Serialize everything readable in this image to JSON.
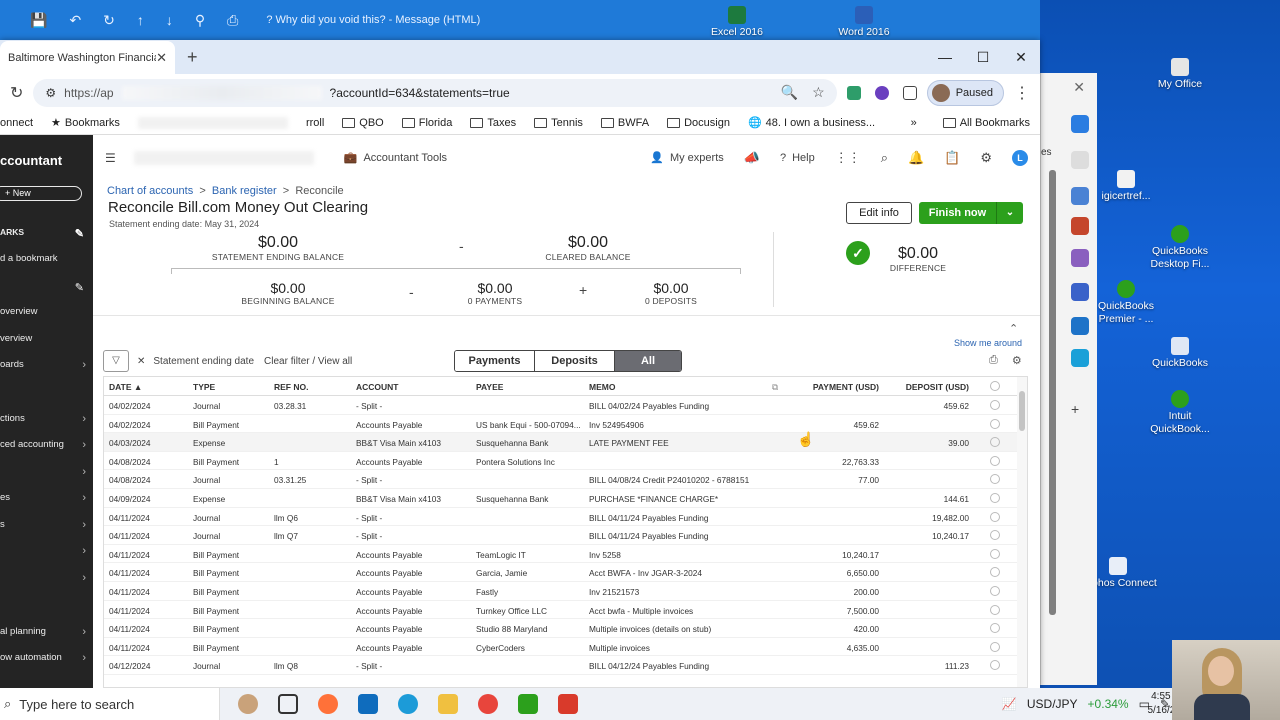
{
  "top_strip": {
    "message_title": "? Why did you void this? - Message (HTML)",
    "excel_label": "Excel 2016",
    "word_label": "Word 2016"
  },
  "desktop_icons": [
    {
      "label": "My Office"
    },
    {
      "label": "igicertref..."
    },
    {
      "label": "QuickBooks Desktop Fi..."
    },
    {
      "label": "QuickBooks Premier - ..."
    },
    {
      "label": "QuickBooks"
    },
    {
      "label": "Intuit QuickBook..."
    },
    {
      "label": "Sophos Connect"
    }
  ],
  "side_panel": {
    "label": "es"
  },
  "browser": {
    "tab_title": "Baltimore Washington Financial",
    "url_prefix": "https://ap",
    "url_suffix": "?accountId=634&statements=true",
    "profile_status": "Paused",
    "bookmarks": {
      "first": "onnect",
      "bookmarks_label": "Bookmarks",
      "items": [
        "rroll",
        "QBO",
        "Florida",
        "Taxes",
        "Tennis",
        "BWFA",
        "Docusign",
        "48. I own a business..."
      ],
      "all_bookmarks": "All Bookmarks"
    }
  },
  "leftnav": {
    "brand": "ccountant",
    "new_label": "+ New",
    "items": [
      {
        "label": "ARKS"
      },
      {
        "label": "d a bookmark"
      },
      {
        "label": "overview"
      },
      {
        "label": "verview"
      },
      {
        "label": "oards"
      },
      {
        "label": "ctions"
      },
      {
        "label": "ced accounting"
      },
      {
        "label": "es"
      },
      {
        "label": "s"
      },
      {
        "label": "al planning"
      },
      {
        "label": "ow automation"
      }
    ]
  },
  "topbar": {
    "accountant_tools": "Accountant Tools",
    "my_experts": "My experts",
    "help": "Help"
  },
  "page": {
    "crumb_1": "Chart of accounts",
    "crumb_2": "Bank register",
    "crumb_3": "Reconcile",
    "title": "Reconcile   Bill.com Money Out Clearing",
    "statement_date": "Statement ending date: May 31, 2024",
    "edit_info": "Edit info",
    "finish_now": "Finish now",
    "show_me_around": "Show me around"
  },
  "balances": {
    "statement_ending": {
      "amount": "$0.00",
      "label": "STATEMENT ENDING BALANCE"
    },
    "cleared": {
      "amount": "$0.00",
      "label": "CLEARED BALANCE"
    },
    "beginning": {
      "amount": "$0.00",
      "label": "BEGINNING BALANCE"
    },
    "payments": {
      "amount": "$0.00",
      "label": "0 PAYMENTS"
    },
    "deposits": {
      "amount": "$0.00",
      "label": "0 DEPOSITS"
    },
    "difference": {
      "amount": "$0.00",
      "label": "DIFFERENCE"
    },
    "minus": "-",
    "plus": "+"
  },
  "filters": {
    "filter_chip": "Statement ending date",
    "clear_filter": "Clear filter / View all",
    "seg_payments": "Payments",
    "seg_deposits": "Deposits",
    "seg_all": "All"
  },
  "table": {
    "headers": {
      "date": "DATE ▲",
      "type": "TYPE",
      "ref": "REF NO.",
      "account": "ACCOUNT",
      "payee": "PAYEE",
      "memo": "MEMO",
      "payment": "PAYMENT (USD)",
      "deposit": "DEPOSIT (USD)"
    },
    "rows": [
      {
        "date": "04/02/2024",
        "type": "Journal",
        "ref": "03.28.31",
        "account": "- Split -",
        "payee": "",
        "memo": "BILL 04/02/24 Payables Funding",
        "payment": "",
        "deposit": "459.62"
      },
      {
        "date": "04/02/2024",
        "type": "Bill Payment",
        "ref": "",
        "account": "Accounts Payable",
        "payee": "US bank Equi - 500-07094...",
        "memo": "Inv 524954906",
        "payment": "459.62",
        "deposit": ""
      },
      {
        "date": "04/03/2024",
        "type": "Expense",
        "ref": "",
        "account": "BB&T Visa Main x4103",
        "payee": "Susquehanna Bank",
        "memo": "LATE PAYMENT FEE",
        "payment": "",
        "deposit": "39.00"
      },
      {
        "date": "04/08/2024",
        "type": "Bill Payment",
        "ref": "1",
        "account": "Accounts Payable",
        "payee": "Pontera Solutions Inc",
        "memo": "",
        "payment": "22,763.33",
        "deposit": ""
      },
      {
        "date": "04/08/2024",
        "type": "Journal",
        "ref": "03.31.25",
        "account": "- Split -",
        "payee": "",
        "memo": "BILL 04/08/24 Credit P24010202 - 6788151",
        "payment": "77.00",
        "deposit": ""
      },
      {
        "date": "04/09/2024",
        "type": "Expense",
        "ref": "",
        "account": "BB&T Visa Main x4103",
        "payee": "Susquehanna Bank",
        "memo": "PURCHASE *FINANCE CHARGE*",
        "payment": "",
        "deposit": "144.61"
      },
      {
        "date": "04/11/2024",
        "type": "Journal",
        "ref": "llm Q6",
        "account": "- Split -",
        "payee": "",
        "memo": "BILL 04/11/24 Payables Funding",
        "payment": "",
        "deposit": "19,482.00"
      },
      {
        "date": "04/11/2024",
        "type": "Journal",
        "ref": "llm Q7",
        "account": "- Split -",
        "payee": "",
        "memo": "BILL 04/11/24 Payables Funding",
        "payment": "",
        "deposit": "10,240.17"
      },
      {
        "date": "04/11/2024",
        "type": "Bill Payment",
        "ref": "",
        "account": "Accounts Payable",
        "payee": "TeamLogic IT",
        "memo": "Inv 5258",
        "payment": "10,240.17",
        "deposit": ""
      },
      {
        "date": "04/11/2024",
        "type": "Bill Payment",
        "ref": "",
        "account": "Accounts Payable",
        "payee": "Garcia, Jamie",
        "memo": "Acct BWFA - Inv JGAR-3-2024",
        "payment": "6,650.00",
        "deposit": ""
      },
      {
        "date": "04/11/2024",
        "type": "Bill Payment",
        "ref": "",
        "account": "Accounts Payable",
        "payee": "Fastly",
        "memo": "Inv 21521573",
        "payment": "200.00",
        "deposit": ""
      },
      {
        "date": "04/11/2024",
        "type": "Bill Payment",
        "ref": "",
        "account": "Accounts Payable",
        "payee": "Turnkey Office LLC",
        "memo": "Acct bwfa - Multiple invoices",
        "payment": "7,500.00",
        "deposit": ""
      },
      {
        "date": "04/11/2024",
        "type": "Bill Payment",
        "ref": "",
        "account": "Accounts Payable",
        "payee": "Studio 88 Maryland",
        "memo": "Multiple invoices (details on stub)",
        "payment": "420.00",
        "deposit": ""
      },
      {
        "date": "04/11/2024",
        "type": "Bill Payment",
        "ref": "",
        "account": "Accounts Payable",
        "payee": "CyberCoders",
        "memo": "Multiple invoices",
        "payment": "4,635.00",
        "deposit": ""
      },
      {
        "date": "04/12/2024",
        "type": "Journal",
        "ref": "llm Q8",
        "account": "- Split -",
        "payee": "",
        "memo": "BILL 04/12/24 Payables Funding",
        "payment": "",
        "deposit": "111.23"
      }
    ]
  },
  "taskbar": {
    "search_placeholder": "Type here to search",
    "ticker": "USD/JPY",
    "ticker_change": "+0.34%",
    "time": "4:55 PM",
    "date": "5/16/2024"
  }
}
